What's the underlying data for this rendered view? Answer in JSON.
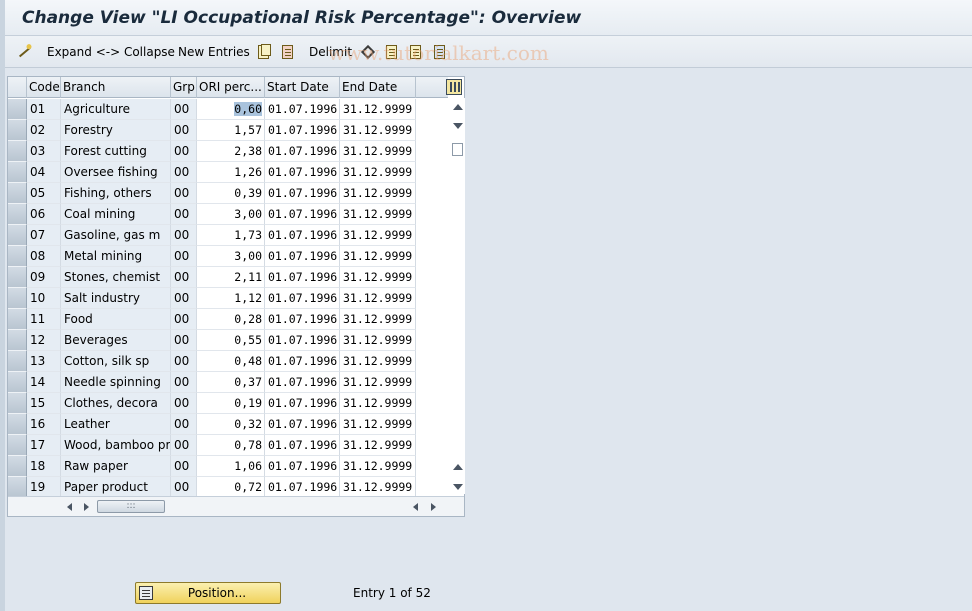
{
  "window": {
    "title": "Change View \"LI Occupational Risk Percentage\": Overview"
  },
  "toolbar": {
    "expand_collapse_label": "Expand <-> Collapse",
    "new_entries_label": "New Entries",
    "delimit_label": "Delimit"
  },
  "watermark": "www.tutorialkart.com",
  "table": {
    "columns": {
      "code": "Code",
      "branch": "Branch",
      "grp": "Grp",
      "ori": "ORI perc...",
      "start": "Start Date",
      "end": "End Date"
    },
    "rows": [
      {
        "code": "01",
        "branch": "Agriculture",
        "grp": "00",
        "ori": "0,60",
        "start": "01.07.1996",
        "end": "31.12.9999"
      },
      {
        "code": "02",
        "branch": "Forestry",
        "grp": "00",
        "ori": "1,57",
        "start": "01.07.1996",
        "end": "31.12.9999"
      },
      {
        "code": "03",
        "branch": "Forest cutting",
        "grp": "00",
        "ori": "2,38",
        "start": "01.07.1996",
        "end": "31.12.9999"
      },
      {
        "code": "04",
        "branch": "Oversee fishing",
        "grp": "00",
        "ori": "1,26",
        "start": "01.07.1996",
        "end": "31.12.9999"
      },
      {
        "code": "05",
        "branch": "Fishing, others",
        "grp": "00",
        "ori": "0,39",
        "start": "01.07.1996",
        "end": "31.12.9999"
      },
      {
        "code": "06",
        "branch": "Coal mining",
        "grp": "00",
        "ori": "3,00",
        "start": "01.07.1996",
        "end": "31.12.9999"
      },
      {
        "code": "07",
        "branch": "Gasoline, gas m",
        "grp": "00",
        "ori": "1,73",
        "start": "01.07.1996",
        "end": "31.12.9999"
      },
      {
        "code": "08",
        "branch": "Metal mining",
        "grp": "00",
        "ori": "3,00",
        "start": "01.07.1996",
        "end": "31.12.9999"
      },
      {
        "code": "09",
        "branch": "Stones, chemist",
        "grp": "00",
        "ori": "2,11",
        "start": "01.07.1996",
        "end": "31.12.9999"
      },
      {
        "code": "10",
        "branch": "Salt industry",
        "grp": "00",
        "ori": "1,12",
        "start": "01.07.1996",
        "end": "31.12.9999"
      },
      {
        "code": "11",
        "branch": "Food",
        "grp": "00",
        "ori": "0,28",
        "start": "01.07.1996",
        "end": "31.12.9999"
      },
      {
        "code": "12",
        "branch": "Beverages",
        "grp": "00",
        "ori": "0,55",
        "start": "01.07.1996",
        "end": "31.12.9999"
      },
      {
        "code": "13",
        "branch": "Cotton, silk sp",
        "grp": "00",
        "ori": "0,48",
        "start": "01.07.1996",
        "end": "31.12.9999"
      },
      {
        "code": "14",
        "branch": "Needle spinning",
        "grp": "00",
        "ori": "0,37",
        "start": "01.07.1996",
        "end": "31.12.9999"
      },
      {
        "code": "15",
        "branch": "Clothes, decora",
        "grp": "00",
        "ori": "0,19",
        "start": "01.07.1996",
        "end": "31.12.9999"
      },
      {
        "code": "16",
        "branch": "Leather",
        "grp": "00",
        "ori": "0,32",
        "start": "01.07.1996",
        "end": "31.12.9999"
      },
      {
        "code": "17",
        "branch": "Wood, bamboo pr",
        "grp": "00",
        "ori": "0,78",
        "start": "01.07.1996",
        "end": "31.12.9999"
      },
      {
        "code": "18",
        "branch": "Raw paper",
        "grp": "00",
        "ori": "1,06",
        "start": "01.07.1996",
        "end": "31.12.9999"
      },
      {
        "code": "19",
        "branch": "Paper product",
        "grp": "00",
        "ori": "0,72",
        "start": "01.07.1996",
        "end": "31.12.9999"
      }
    ]
  },
  "footer": {
    "position_button_label": "Position...",
    "entry_info": "Entry 1 of 52"
  }
}
